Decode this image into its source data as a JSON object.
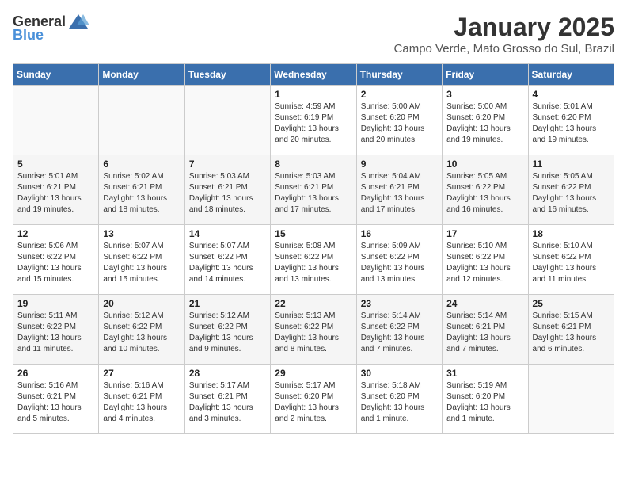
{
  "logo": {
    "general": "General",
    "blue": "Blue"
  },
  "title": "January 2025",
  "subtitle": "Campo Verde, Mato Grosso do Sul, Brazil",
  "headers": [
    "Sunday",
    "Monday",
    "Tuesday",
    "Wednesday",
    "Thursday",
    "Friday",
    "Saturday"
  ],
  "weeks": [
    [
      {
        "day": "",
        "info": ""
      },
      {
        "day": "",
        "info": ""
      },
      {
        "day": "",
        "info": ""
      },
      {
        "day": "1",
        "info": "Sunrise: 4:59 AM\nSunset: 6:19 PM\nDaylight: 13 hours\nand 20 minutes."
      },
      {
        "day": "2",
        "info": "Sunrise: 5:00 AM\nSunset: 6:20 PM\nDaylight: 13 hours\nand 20 minutes."
      },
      {
        "day": "3",
        "info": "Sunrise: 5:00 AM\nSunset: 6:20 PM\nDaylight: 13 hours\nand 19 minutes."
      },
      {
        "day": "4",
        "info": "Sunrise: 5:01 AM\nSunset: 6:20 PM\nDaylight: 13 hours\nand 19 minutes."
      }
    ],
    [
      {
        "day": "5",
        "info": "Sunrise: 5:01 AM\nSunset: 6:21 PM\nDaylight: 13 hours\nand 19 minutes."
      },
      {
        "day": "6",
        "info": "Sunrise: 5:02 AM\nSunset: 6:21 PM\nDaylight: 13 hours\nand 18 minutes."
      },
      {
        "day": "7",
        "info": "Sunrise: 5:03 AM\nSunset: 6:21 PM\nDaylight: 13 hours\nand 18 minutes."
      },
      {
        "day": "8",
        "info": "Sunrise: 5:03 AM\nSunset: 6:21 PM\nDaylight: 13 hours\nand 17 minutes."
      },
      {
        "day": "9",
        "info": "Sunrise: 5:04 AM\nSunset: 6:21 PM\nDaylight: 13 hours\nand 17 minutes."
      },
      {
        "day": "10",
        "info": "Sunrise: 5:05 AM\nSunset: 6:22 PM\nDaylight: 13 hours\nand 16 minutes."
      },
      {
        "day": "11",
        "info": "Sunrise: 5:05 AM\nSunset: 6:22 PM\nDaylight: 13 hours\nand 16 minutes."
      }
    ],
    [
      {
        "day": "12",
        "info": "Sunrise: 5:06 AM\nSunset: 6:22 PM\nDaylight: 13 hours\nand 15 minutes."
      },
      {
        "day": "13",
        "info": "Sunrise: 5:07 AM\nSunset: 6:22 PM\nDaylight: 13 hours\nand 15 minutes."
      },
      {
        "day": "14",
        "info": "Sunrise: 5:07 AM\nSunset: 6:22 PM\nDaylight: 13 hours\nand 14 minutes."
      },
      {
        "day": "15",
        "info": "Sunrise: 5:08 AM\nSunset: 6:22 PM\nDaylight: 13 hours\nand 13 minutes."
      },
      {
        "day": "16",
        "info": "Sunrise: 5:09 AM\nSunset: 6:22 PM\nDaylight: 13 hours\nand 13 minutes."
      },
      {
        "day": "17",
        "info": "Sunrise: 5:10 AM\nSunset: 6:22 PM\nDaylight: 13 hours\nand 12 minutes."
      },
      {
        "day": "18",
        "info": "Sunrise: 5:10 AM\nSunset: 6:22 PM\nDaylight: 13 hours\nand 11 minutes."
      }
    ],
    [
      {
        "day": "19",
        "info": "Sunrise: 5:11 AM\nSunset: 6:22 PM\nDaylight: 13 hours\nand 11 minutes."
      },
      {
        "day": "20",
        "info": "Sunrise: 5:12 AM\nSunset: 6:22 PM\nDaylight: 13 hours\nand 10 minutes."
      },
      {
        "day": "21",
        "info": "Sunrise: 5:12 AM\nSunset: 6:22 PM\nDaylight: 13 hours\nand 9 minutes."
      },
      {
        "day": "22",
        "info": "Sunrise: 5:13 AM\nSunset: 6:22 PM\nDaylight: 13 hours\nand 8 minutes."
      },
      {
        "day": "23",
        "info": "Sunrise: 5:14 AM\nSunset: 6:22 PM\nDaylight: 13 hours\nand 7 minutes."
      },
      {
        "day": "24",
        "info": "Sunrise: 5:14 AM\nSunset: 6:21 PM\nDaylight: 13 hours\nand 7 minutes."
      },
      {
        "day": "25",
        "info": "Sunrise: 5:15 AM\nSunset: 6:21 PM\nDaylight: 13 hours\nand 6 minutes."
      }
    ],
    [
      {
        "day": "26",
        "info": "Sunrise: 5:16 AM\nSunset: 6:21 PM\nDaylight: 13 hours\nand 5 minutes."
      },
      {
        "day": "27",
        "info": "Sunrise: 5:16 AM\nSunset: 6:21 PM\nDaylight: 13 hours\nand 4 minutes."
      },
      {
        "day": "28",
        "info": "Sunrise: 5:17 AM\nSunset: 6:21 PM\nDaylight: 13 hours\nand 3 minutes."
      },
      {
        "day": "29",
        "info": "Sunrise: 5:17 AM\nSunset: 6:20 PM\nDaylight: 13 hours\nand 2 minutes."
      },
      {
        "day": "30",
        "info": "Sunrise: 5:18 AM\nSunset: 6:20 PM\nDaylight: 13 hours\nand 1 minute."
      },
      {
        "day": "31",
        "info": "Sunrise: 5:19 AM\nSunset: 6:20 PM\nDaylight: 13 hours\nand 1 minute."
      },
      {
        "day": "",
        "info": ""
      }
    ]
  ]
}
